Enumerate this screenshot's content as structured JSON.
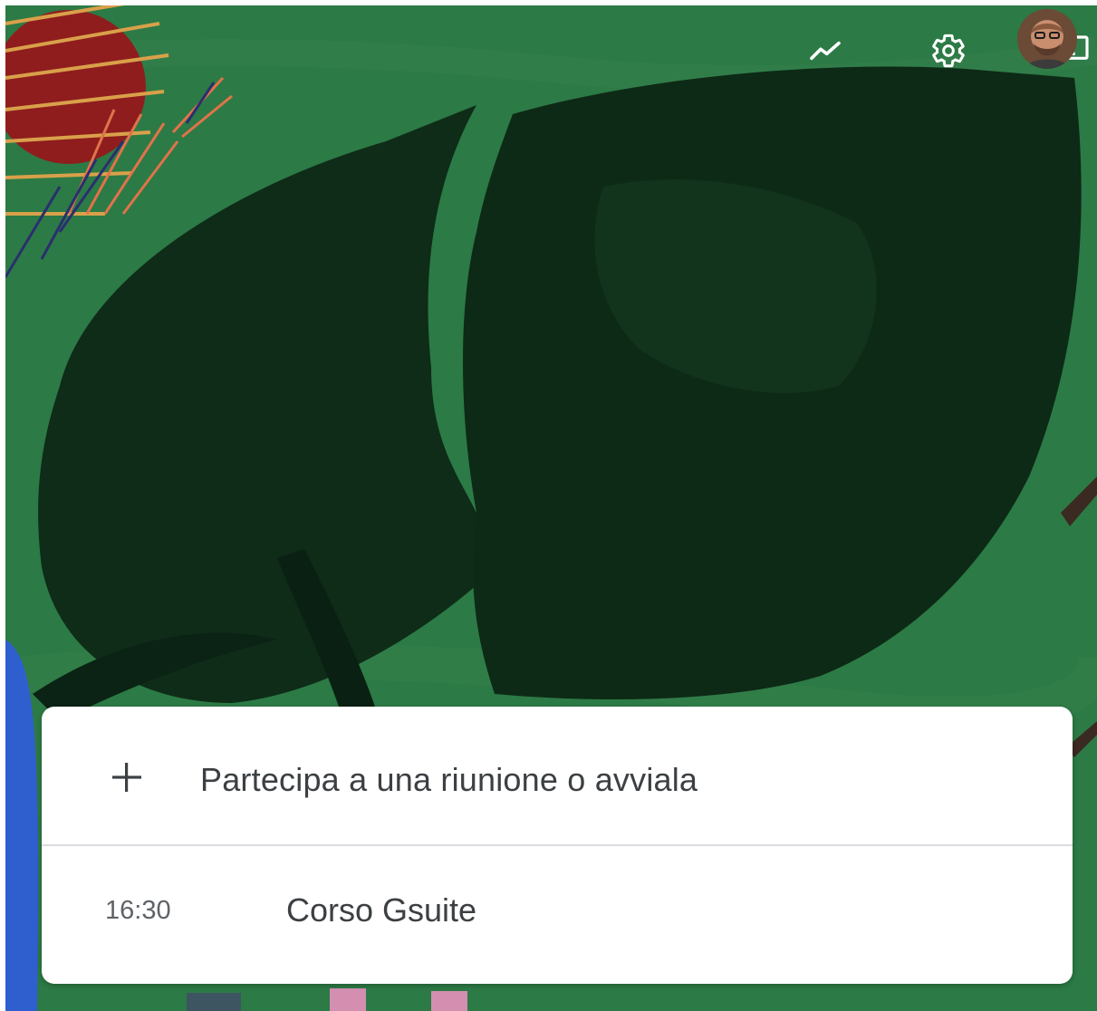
{
  "topbar": {
    "icons": [
      "trending-up-icon",
      "settings-gear-icon",
      "feedback-icon"
    ],
    "avatar": "user-avatar",
    "icon_color": "#ffffff"
  },
  "card": {
    "join_action_label": "Partecipa a una riunione o avviala",
    "meetings": [
      {
        "time": "16:30",
        "title": "Corso Gsuite"
      }
    ]
  },
  "colors": {
    "background_green": "#2c7a45",
    "leaf_dark": "#0d2a17",
    "card_bg": "#ffffff",
    "text_primary": "#3c4043",
    "text_secondary": "#5f6368"
  }
}
